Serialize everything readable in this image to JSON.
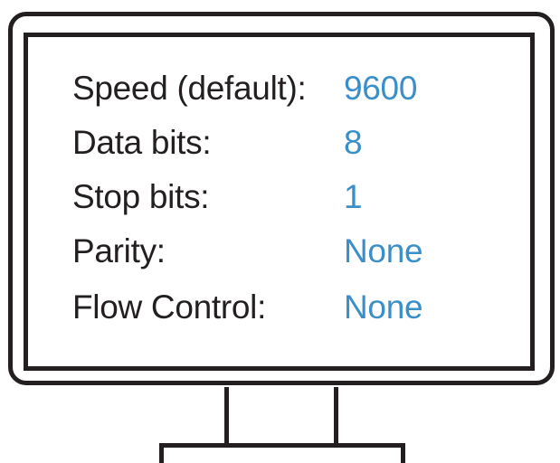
{
  "colors": {
    "outline": "#231f20",
    "label_text": "#231f20",
    "value_text": "#3a8fc9",
    "background": "#ffffff"
  },
  "settings": [
    {
      "label": "Speed (default):",
      "value": "9600"
    },
    {
      "label": "Data bits:",
      "value": "8"
    },
    {
      "label": "Stop bits:",
      "value": "1"
    },
    {
      "label": "Parity:",
      "value": "None"
    },
    {
      "label": "Flow Control:",
      "value": "None"
    }
  ]
}
